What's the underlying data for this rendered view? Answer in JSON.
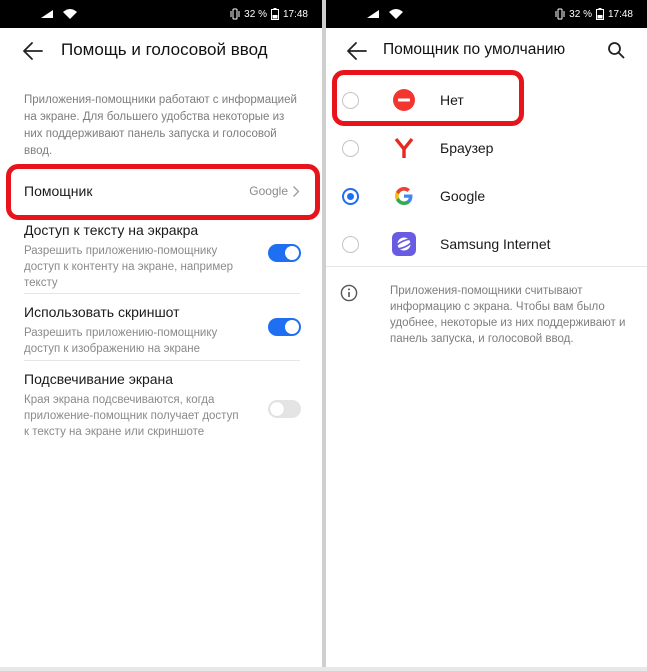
{
  "status_bar": {
    "battery": "32 %",
    "time": "17:48"
  },
  "left": {
    "title": "Помощь и голосовой ввод",
    "description": "Приложения-помощники работают с информацией на экране. Для большего удобства некоторые из них поддерживают панель запуска и голосовой ввод.",
    "assistant": {
      "label": "Помощник",
      "value": "Google"
    },
    "toggles": [
      {
        "title": "Доступ к тексту на экракра",
        "subtitle": "Разрешить приложению-помощнику доступ к контенту на экране, например тексту",
        "enabled": true
      },
      {
        "title": "Использовать скриншот",
        "subtitle": "Разрешить приложению-помощнику доступ к изображению на экране",
        "enabled": true
      },
      {
        "title": "Подсвечивание экрана",
        "subtitle": "Края экрана подсвечиваются, когда приложение-помощник получает доступ к тексту на экране или скриншоте",
        "enabled": false
      }
    ]
  },
  "right": {
    "title": "Помощник по умолчанию",
    "options": [
      {
        "label": "Нет",
        "icon": "none-icon",
        "selected": false
      },
      {
        "label": "Браузер",
        "icon": "yandex-browser-icon",
        "selected": false
      },
      {
        "label": "Google",
        "icon": "google-icon",
        "selected": true
      },
      {
        "label": "Samsung Internet",
        "icon": "samsung-internet-icon",
        "selected": false
      }
    ],
    "info": "Приложения-помощники считывают информацию с экрана. Чтобы вам было удобнее, некоторые из них поддерживают и панель запуска, и голосовой ввод."
  },
  "colors": {
    "accent": "#1e6ff2",
    "highlight": "#e8141c",
    "none_icon": "#f2362f",
    "yandex": "#e32b1f",
    "samsung": "#6a5ce2"
  }
}
